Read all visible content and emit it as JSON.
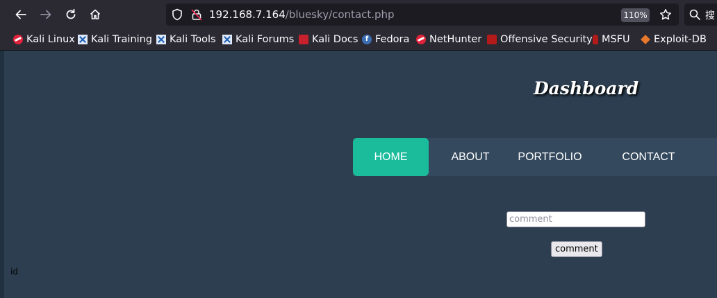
{
  "browser": {
    "url": {
      "host": "192.168.7.164",
      "path": "/bluesky/contact.php"
    },
    "zoom": "110%",
    "search_text": "搜"
  },
  "bookmarks": [
    {
      "label": "Kali Linux",
      "icon": "kali-dragon-icon"
    },
    {
      "label": "Kali Training",
      "icon": "kali-tools-icon"
    },
    {
      "label": "Kali Tools",
      "icon": "kali-tools-icon"
    },
    {
      "label": "Kali Forums",
      "icon": "kali-tools-icon"
    },
    {
      "label": "Kali Docs",
      "icon": "kali-docs-icon"
    },
    {
      "label": "Fedora",
      "icon": "fedora-icon"
    },
    {
      "label": "NetHunter",
      "icon": "kali-dragon-icon"
    },
    {
      "label": "Offensive Security",
      "icon": "offsec-icon"
    },
    {
      "label": "MSFU",
      "icon": "msfu-icon"
    },
    {
      "label": "Exploit-DB",
      "icon": "exploit-db-icon"
    }
  ],
  "site": {
    "brand": "Dashboard",
    "menu": [
      {
        "label": "HOME",
        "active": true
      },
      {
        "label": "ABOUT",
        "active": false
      },
      {
        "label": "PORTFOLIO",
        "active": false
      },
      {
        "label": "CONTACT",
        "active": false
      }
    ],
    "comment_placeholder": "comment",
    "comment_button": "comment",
    "id_label": "id"
  },
  "colors": {
    "page_bg": "#2c3e50",
    "menu_bg": "#34495e",
    "menu_active": "#1abc9c"
  }
}
